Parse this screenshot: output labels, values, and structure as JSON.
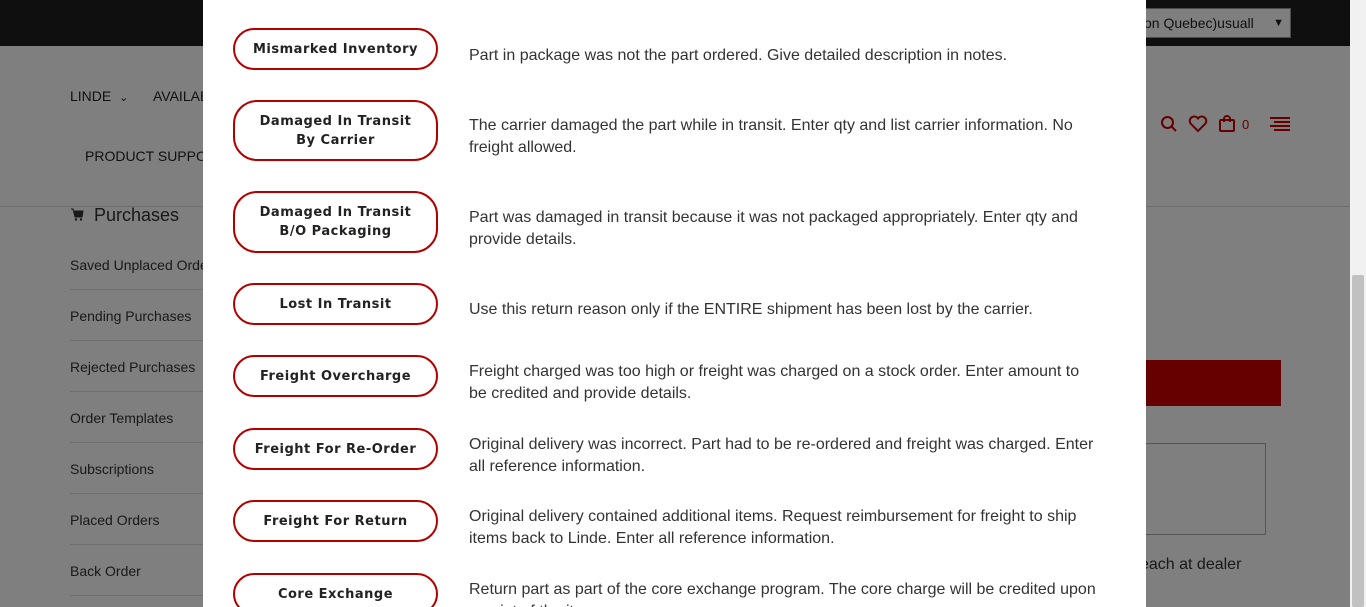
{
  "header": {
    "region_select_value": "tion Quebec)usuall"
  },
  "nav": {
    "items": [
      {
        "label": "LINDE"
      },
      {
        "label": "AVAILAB"
      },
      {
        "label": "PRODUCT SUPPOR"
      }
    ],
    "cart_count": "0"
  },
  "sidebar": {
    "title": "Purchases",
    "links": [
      {
        "label": "Saved Unplaced Orde"
      },
      {
        "label": "Pending Purchases"
      },
      {
        "label": "Rejected Purchases"
      },
      {
        "label": "Order Templates"
      },
      {
        "label": "Subscriptions"
      },
      {
        "label": "Placed Orders"
      },
      {
        "label": "Back Order"
      }
    ]
  },
  "background": {
    "dealer_text": "each at dealer"
  },
  "modal": {
    "reasons": [
      {
        "label": "Mismarked Inventory",
        "description": "Part in package was not the part ordered. Give detailed description in notes."
      },
      {
        "label": "Damaged In Transit\nBy Carrier",
        "description": "The carrier damaged the part while in transit. Enter qty and list carrier information. No freight allowed."
      },
      {
        "label": "Damaged In Transit\nB/O Packaging",
        "description": "Part was damaged in transit because it was not packaged appropriately. Enter qty and provide details."
      },
      {
        "label": "Lost In Transit",
        "description": "Use this return reason only if the ENTIRE shipment has been lost by the carrier."
      },
      {
        "label": "Freight Overcharge",
        "description": "Freight charged was too high or freight was charged on a stock order. Enter amount to be credited and provide details."
      },
      {
        "label": "Freight For Re-Order",
        "description": "Original delivery was incorrect. Part had to be re-ordered and freight was charged. Enter all reference information."
      },
      {
        "label": "Freight For Return",
        "description": "Original delivery contained additional items. Request reimbursement for freight to ship items back to Linde. Enter all reference information."
      },
      {
        "label": "Core Exchange",
        "description": "Return part as part of the core exchange program. The core charge will be credited upon receipt of the item."
      }
    ]
  },
  "colors": {
    "accent": "#b00000",
    "topbar": "#1f1f1f"
  }
}
